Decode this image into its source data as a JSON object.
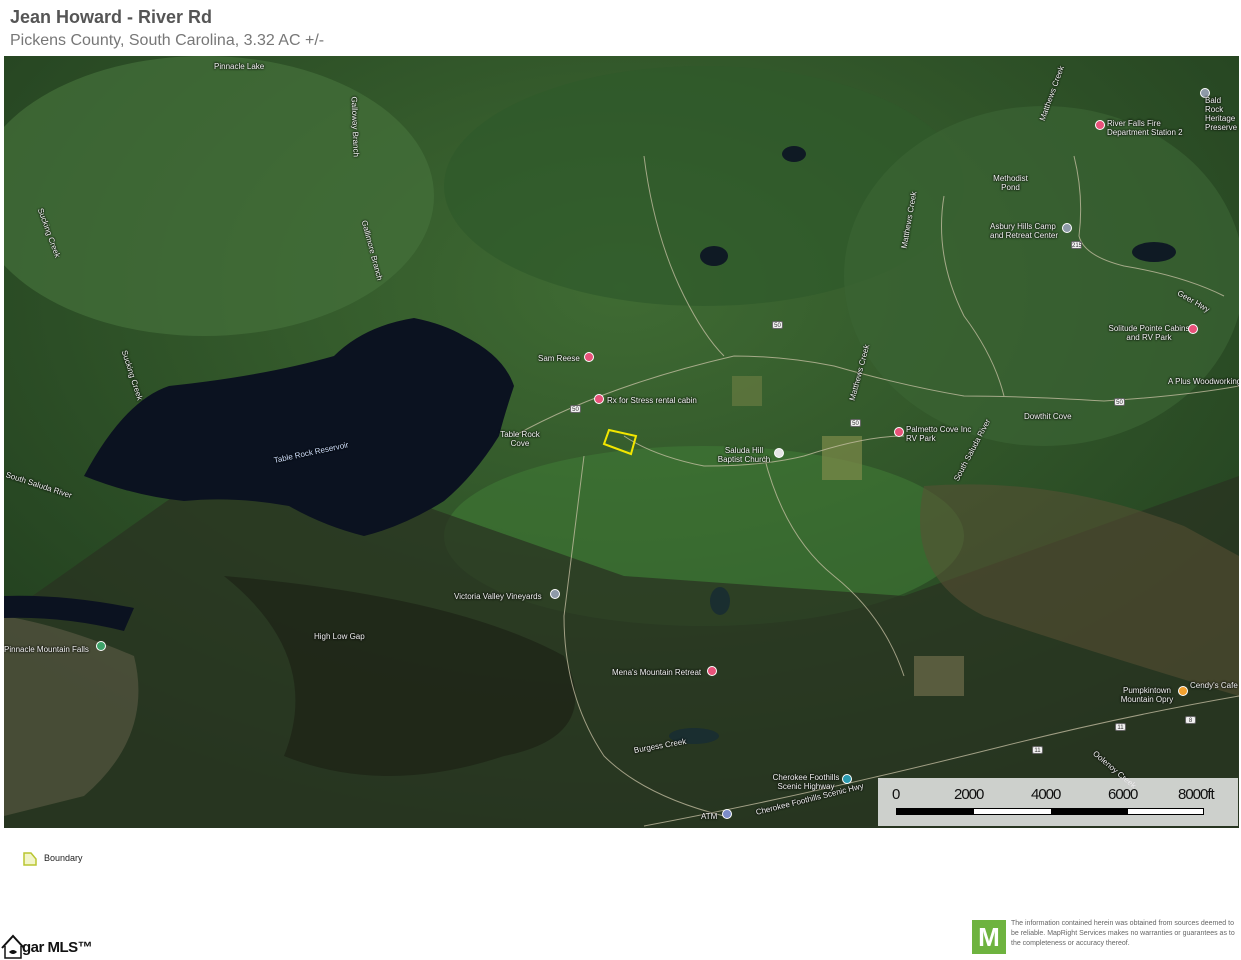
{
  "header": {
    "title": "Jean Howard - River Rd",
    "subtitle": "Pickens County, South Carolina, 3.32 AC +/-"
  },
  "map": {
    "base_layer": "satellite",
    "boundary_color": "#f2e600",
    "labels": {
      "pinnacle_lake": "Pinnacle Lake",
      "galloway_branch": "Galloway Branch",
      "gallimore_branch": "Gallimore Branch",
      "sucking_creek_1": "Sucking Creek",
      "sucking_creek_2": "Sucking Creek",
      "mathews_creek_1": "Matthews Creek",
      "mathews_creek_2": "Matthews Creek",
      "mathews_creek_3": "Matthews Creek",
      "methodist_pond": "Methodist Pond",
      "asbury": "Asbury Hills Camp and Retreat Center",
      "river_falls": "River Falls Fire Department Station 2",
      "bald_rock": "Bald Rock Heritage Preserve",
      "solitude": "Solitude Pointe Cabins and RV Park",
      "aplus": "A Plus Woodworking",
      "geer_hwy": "Geer Hwy",
      "dowthit_cove": "Dowthit Cove",
      "sam_reese": "Sam Reese",
      "rx_stress": "Rx for Stress rental cabin",
      "table_rock_cove": "Table Rock Cove",
      "table_rock_reservoir": "Table Rock Reservoir",
      "south_saluda_river_1": "South Saluda River",
      "south_saluda_river_2": "South Saluda River",
      "saluda_hill": "Saluda Hill Baptist Church",
      "palmetto_cove": "Palmetto Cove Inc RV Park",
      "victoria_valley": "Victoria Valley Vineyards",
      "high_low_gap": "High Low Gap",
      "pinnacle_falls": "Pinnacle Mountain Falls",
      "menas": "Mena's Mountain Retreat",
      "burgess_creek": "Burgess Creek",
      "pumpkintown": "Pumpkintown Mountain Opry",
      "cendys": "Cendy's Cafe",
      "oolenoy": "Oolenoy Creek",
      "cherokee_foothills": "Cherokee Foothills Scenic Highway",
      "cherokee_road": "Cherokee Foothills Scenic Hwy",
      "atm": "ATM"
    },
    "shields": {
      "r1": "50",
      "r2": "50",
      "r3": "50",
      "r4": "50",
      "r5": "215",
      "r6": "11",
      "r7": "8",
      "r8": "11"
    },
    "scale": {
      "ticks": [
        "0",
        "2000",
        "4000",
        "6000",
        "8000ft"
      ]
    }
  },
  "legend": {
    "items": [
      {
        "label": "Boundary",
        "color": "#d4e04a"
      }
    ]
  },
  "footer": {
    "brand": "gar MLS™",
    "mapright_letter": "M",
    "disclaimer": "The information contained herein was obtained from sources deemed to be reliable. MapRight Services makes no warranties or guarantees as to the completeness or accuracy thereof."
  }
}
